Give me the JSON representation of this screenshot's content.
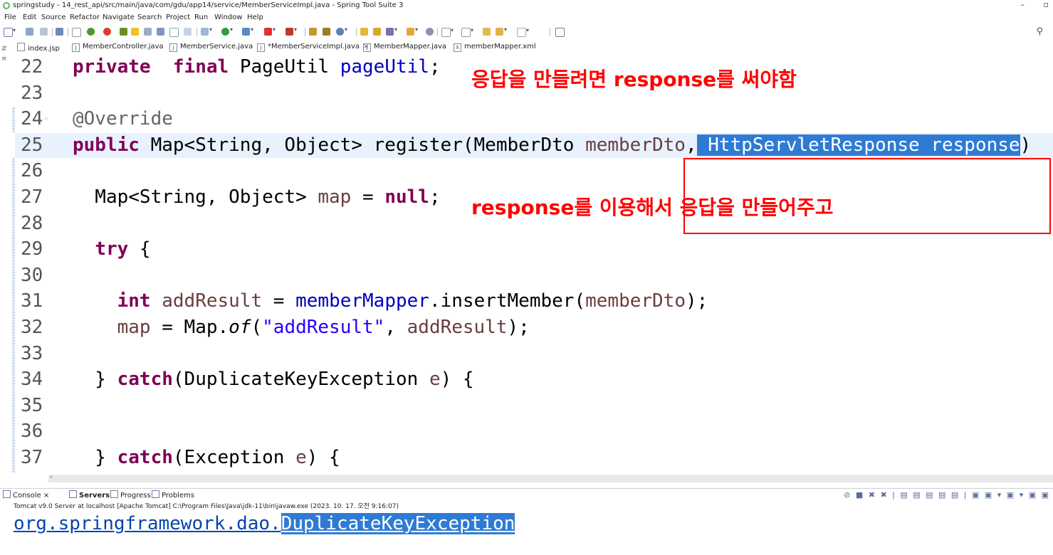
{
  "window": {
    "title": "springstudy - 14_rest_api/src/main/java/com/gdu/app14/service/MemberServiceImpl.java - Spring Tool Suite 3",
    "minimize": "–",
    "maximize": "▫"
  },
  "menu": [
    "File",
    "Edit",
    "Source",
    "Refactor",
    "Navigate",
    "Search",
    "Project",
    "Run",
    "Window",
    "Help"
  ],
  "tabs": [
    {
      "label": "index.jsp",
      "active": false
    },
    {
      "label": "MemberController.java",
      "active": false
    },
    {
      "label": "MemberService.java",
      "active": false
    },
    {
      "label": "*MemberServiceImpl.java",
      "active": true,
      "close": "×"
    },
    {
      "label": "MemberMapper.java",
      "active": false
    },
    {
      "label": "memberMapper.xml",
      "active": false
    }
  ],
  "editor": {
    "lines": [
      {
        "n": "22",
        "t": [
          [
            "kw",
            "private"
          ],
          [
            "",
            "  "
          ],
          [
            "kw",
            "final"
          ],
          [
            "",
            " PageUtil "
          ],
          [
            "fld",
            "pageUtil"
          ],
          [
            "",
            ";"
          ]
        ]
      },
      {
        "n": "23",
        "t": []
      },
      {
        "n": "24",
        "t": [
          [
            "ann",
            "@Override"
          ]
        ],
        "fold": true
      },
      {
        "n": "25",
        "t": [
          [
            "kw",
            "public"
          ],
          [
            "",
            " Map<String, Object> register(MemberDto "
          ],
          [
            "var",
            "memberDto"
          ],
          [
            "",
            ","
          ],
          [
            "sel",
            " HttpServletResponse response"
          ],
          [
            "",
            ")"
          ]
        ],
        "current": true
      },
      {
        "n": "26",
        "t": []
      },
      {
        "n": "27",
        "t": [
          [
            "",
            "  Map<String, Object> "
          ],
          [
            "var",
            "map"
          ],
          [
            "",
            " = "
          ],
          [
            "kw",
            "null"
          ],
          [
            "",
            ";"
          ]
        ]
      },
      {
        "n": "28",
        "t": []
      },
      {
        "n": "29",
        "t": [
          [
            "",
            "  "
          ],
          [
            "kw",
            "try"
          ],
          [
            "",
            " {"
          ]
        ]
      },
      {
        "n": "30",
        "t": []
      },
      {
        "n": "31",
        "t": [
          [
            "",
            "    "
          ],
          [
            "kw",
            "int"
          ],
          [
            "",
            " "
          ],
          [
            "var",
            "addResult"
          ],
          [
            "",
            " = "
          ],
          [
            "fld",
            "memberMapper"
          ],
          [
            "",
            ".insertMember("
          ],
          [
            "var",
            "memberDto"
          ],
          [
            "",
            ");"
          ]
        ]
      },
      {
        "n": "32",
        "t": [
          [
            "",
            "    "
          ],
          [
            "var",
            "map"
          ],
          [
            "",
            " = Map."
          ],
          [
            "ital",
            "of"
          ],
          [
            "",
            "("
          ],
          [
            "str",
            "\"addResult\""
          ],
          [
            "",
            ", "
          ],
          [
            "var",
            "addResult"
          ],
          [
            "",
            ");"
          ]
        ]
      },
      {
        "n": "33",
        "t": []
      },
      {
        "n": "34",
        "t": [
          [
            "",
            "  } "
          ],
          [
            "kw",
            "catch"
          ],
          [
            "",
            "(DuplicateKeyException "
          ],
          [
            "var",
            "e"
          ],
          [
            "",
            ") {"
          ]
        ]
      },
      {
        "n": "35",
        "t": []
      },
      {
        "n": "36",
        "t": []
      },
      {
        "n": "37",
        "t": [
          [
            "",
            "  } "
          ],
          [
            "kw",
            "catch"
          ],
          [
            "",
            "(Exception "
          ],
          [
            "var",
            "e"
          ],
          [
            "",
            ") {"
          ]
        ]
      }
    ]
  },
  "annotations": {
    "note1": "응답을 만들려면 response를 써야함",
    "note2": "response를 이용해서 응답을 만들어주고"
  },
  "console": {
    "tabs": [
      "Console",
      "Servers",
      "Progress",
      "Problems"
    ],
    "description": "Tomcat v9.0 Server at localhost [Apache Tomcat] C:\\Program Files\\Java\\jdk-11\\bin\\javaw.exe  (2023. 10. 17. 오전 9:16:07)",
    "output_prefix": "org.springframework.dao.",
    "output_highlight": "DuplicateKeyException"
  },
  "colors": {
    "keyword": "#7f0055",
    "field": "#0000c0",
    "variable": "#6a3e3e",
    "string": "#2a00ff",
    "selection": "#2f7bd4",
    "annotation_red": "#ff0000",
    "current_line": "#e8f2fe"
  }
}
